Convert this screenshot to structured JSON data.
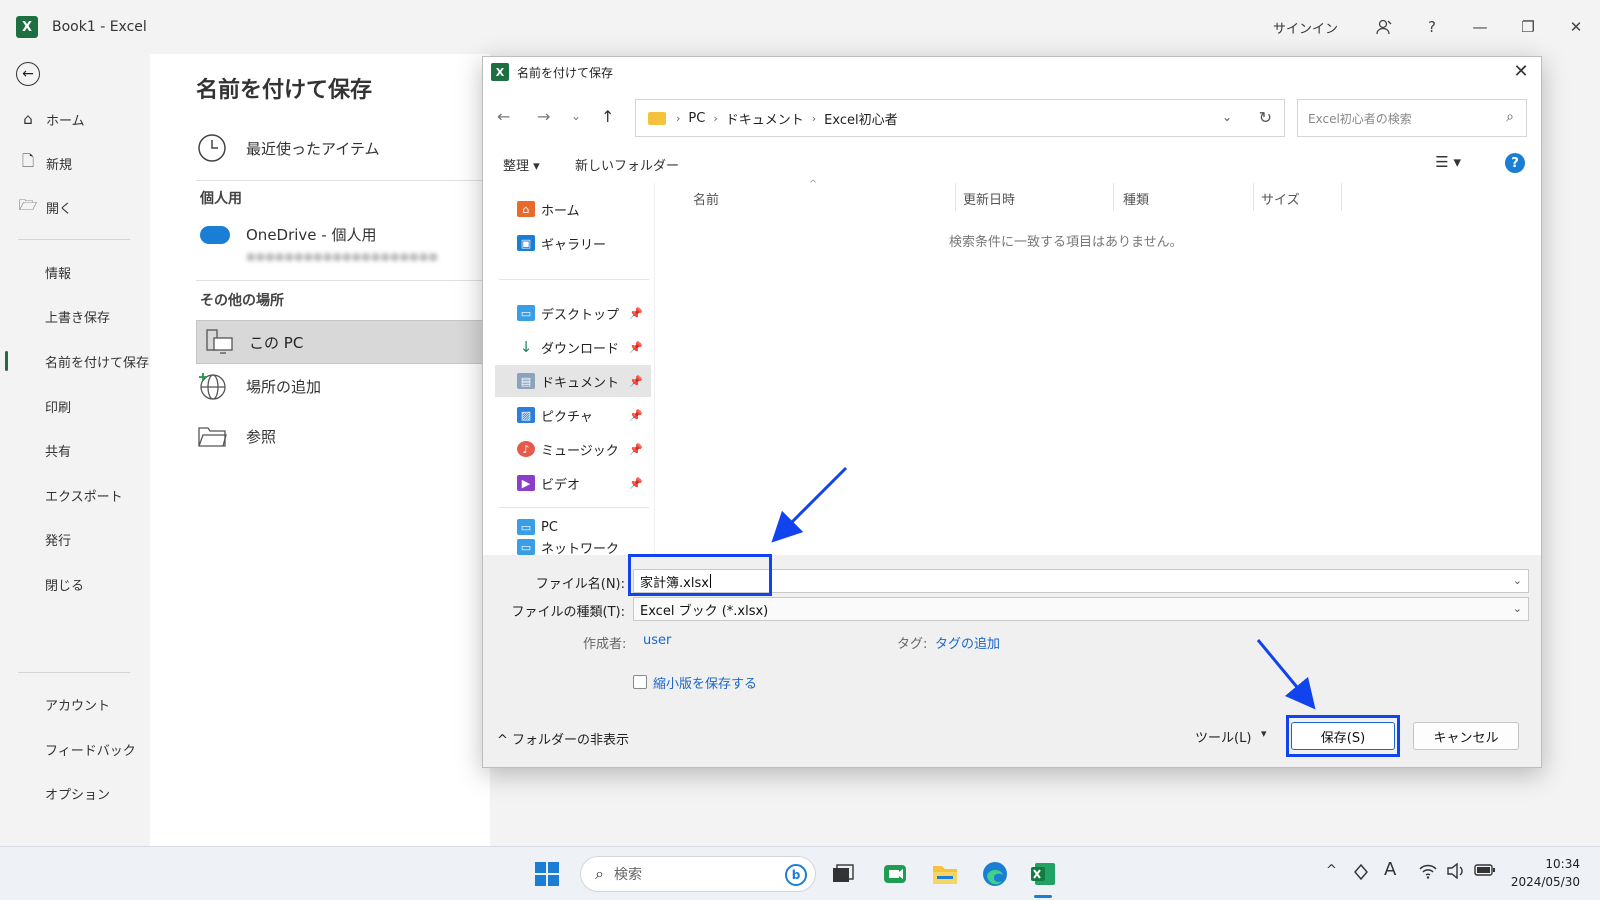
{
  "window": {
    "app_logo": "X",
    "title": "Book1  -  Excel",
    "signin": "サインイン",
    "help": "?",
    "minimize": "—",
    "restore": "❐",
    "close": "✕"
  },
  "backstage": {
    "back_icon": "←",
    "nav_top": [
      {
        "icon": "⌂",
        "label": "ホーム"
      },
      {
        "icon": "🗋",
        "label": "新規"
      },
      {
        "icon": "🗁",
        "label": "開く"
      }
    ],
    "nav_mid": [
      {
        "label": "情報"
      },
      {
        "label": "上書き保存"
      },
      {
        "label": "名前を付けて保存"
      },
      {
        "label": "印刷"
      },
      {
        "label": "共有"
      },
      {
        "label": "エクスポート"
      },
      {
        "label": "発行"
      },
      {
        "label": "閉じる"
      }
    ],
    "nav_bottom": [
      {
        "label": "アカウント"
      },
      {
        "label": "フィードバック"
      },
      {
        "label": "オプション"
      }
    ],
    "page_title": "名前を付けて保存",
    "recent": "最近使ったアイテム",
    "personal_section": "個人用",
    "onedrive": "OneDrive - 個人用",
    "onedrive_email": "●●●●●●●●●●●●●●●●●●●●",
    "other_section": "その他の場所",
    "this_pc": "この PC",
    "add_place": "場所の追加",
    "browse": "参照"
  },
  "dialog": {
    "icon": "X",
    "title": "名前を付けて保存",
    "close": "✕",
    "nav": {
      "back": "←",
      "forward": "→",
      "recent": "⌄",
      "up": "↑"
    },
    "breadcrumb": [
      "PC",
      "ドキュメント",
      "Excel初心者"
    ],
    "breadcrumb_sep": "›",
    "addr_dropdown": "⌄",
    "refresh": "↻",
    "search_placeholder": "Excel初心者の検索",
    "search_icon": "⌕",
    "organize": "整理 ▾",
    "new_folder": "新しいフォルダー",
    "view_icon": "☰ ▾",
    "help": "?",
    "tree": [
      {
        "label": "ホーム",
        "color": "#e86b2c",
        "glyph": "⌂"
      },
      {
        "label": "ギャラリー",
        "color": "#1a7fd4",
        "glyph": "▣"
      },
      {
        "label": "デスクトップ",
        "color": "#3a9ee6",
        "glyph": "▭",
        "pin": true
      },
      {
        "label": "ダウンロード",
        "color": "#1f8a5a",
        "glyph": "↓",
        "pin": true
      },
      {
        "label": "ドキュメント",
        "color": "#8aa2be",
        "glyph": "▤",
        "pin": true
      },
      {
        "label": "ピクチャ",
        "color": "#2a7fd8",
        "glyph": "▨",
        "pin": true
      },
      {
        "label": "ミュージック",
        "color": "#e65a4c",
        "glyph": "♪",
        "pin": true
      },
      {
        "label": "ビデオ",
        "color": "#8a3ec9",
        "glyph": "▶",
        "pin": true
      },
      {
        "label": "PC",
        "color": "#3a9ee6",
        "glyph": "▭"
      },
      {
        "label": "ネットワーク",
        "color": "#3a9ee6",
        "glyph": "▭"
      }
    ],
    "pin_icon": "📌",
    "columns": [
      "名前",
      "更新日時",
      "種類",
      "サイズ"
    ],
    "sort_caret": "^",
    "empty_message": "検索条件に一致する項目はありません。",
    "filename_label": "ファイル名(N):",
    "filename_value": "家計簿.xlsx",
    "filetype_label": "ファイルの種類(T):",
    "filetype_value": "Excel ブック (*.xlsx)",
    "author_label": "作成者:",
    "author_value": "user",
    "tags_label": "タグ:",
    "tags_value": "タグの追加",
    "thumbnail_label": "縮小版を保存する",
    "hide_folders": "^  フォルダーの非表示",
    "tools": "ツール(L)",
    "tools_caret": "▾",
    "save": "保存(S)",
    "cancel": "キャンセル",
    "dd_caret": "⌄"
  },
  "taskbar": {
    "search_placeholder": "検索",
    "search_icon": "⌕",
    "copilot": "b",
    "tray_caret": "^",
    "ime": "A",
    "time": "10:34",
    "date": "2024/05/30"
  },
  "colors": {
    "excel_green": "#1d6f42",
    "accent_blue": "#1a66c9",
    "annotation_blue": "#1144ee"
  }
}
